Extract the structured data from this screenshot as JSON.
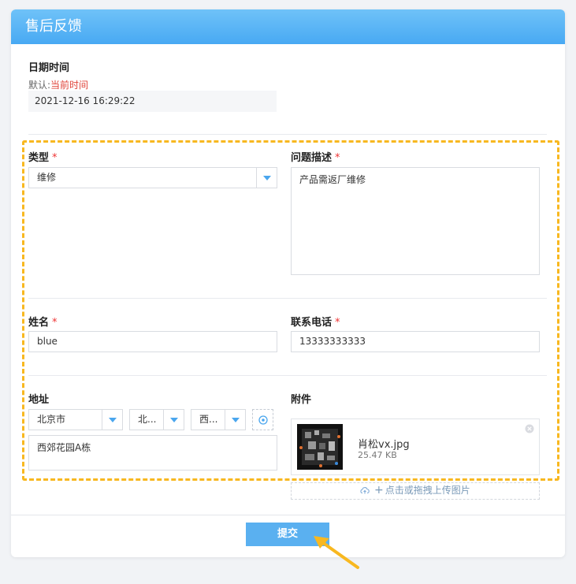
{
  "header": {
    "title": "售后反馈"
  },
  "datetime": {
    "label": "日期时间",
    "hint_prefix": "默认:",
    "hint_value": "当前时间",
    "value": "2021-12-16 16:29:22"
  },
  "type_field": {
    "label": "类型",
    "required": "*",
    "value": "维修"
  },
  "description": {
    "label": "问题描述",
    "required": "*",
    "value": "产品需返厂维修"
  },
  "name_field": {
    "label": "姓名",
    "required": "*",
    "value": "blue"
  },
  "phone_field": {
    "label": "联系电话",
    "required": "*",
    "value": "13333333333"
  },
  "address": {
    "label": "地址",
    "province": "北京市",
    "city": "北...",
    "district": "西...",
    "detail": "西郊花园A栋"
  },
  "attachment": {
    "label": "附件",
    "file_name": "肖松vx.jpg",
    "file_size": "25.47 KB",
    "upload_label": "点击或拖拽上传图片"
  },
  "submit": {
    "label": "提交"
  },
  "colors": {
    "accent": "#4aa6ee",
    "highlight": "#f8b820",
    "required": "#e33333"
  }
}
